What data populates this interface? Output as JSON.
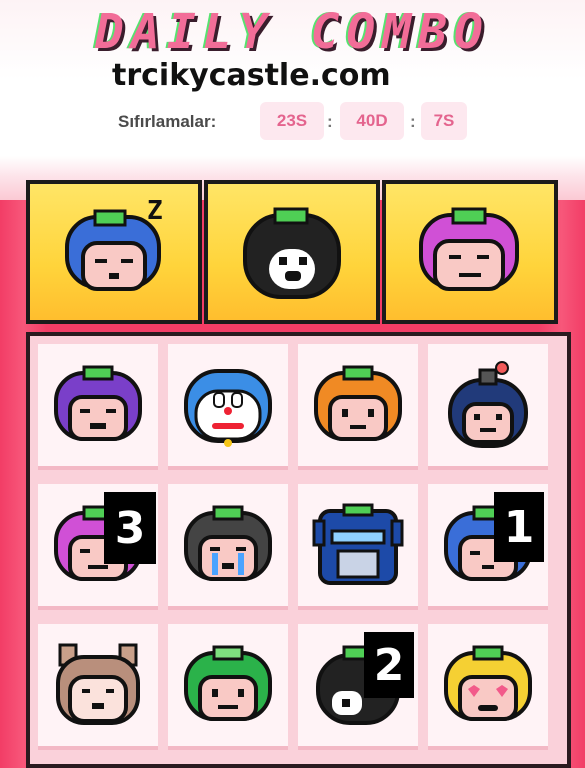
{
  "header": {
    "title": "DAILY COMBO",
    "watermark": "trcikycastle.com"
  },
  "reset": {
    "label": "Sıfırlamalar:",
    "hours": "23S",
    "minutes": "40D",
    "seconds": "7S",
    "separator": ":"
  },
  "combo_slots": [
    {
      "icon": "sleepy-blue-fruit-icon",
      "zz": "Z"
    },
    {
      "icon": "black-white-ghost-fruit-icon"
    },
    {
      "icon": "sad-pink-fruit-icon"
    }
  ],
  "board": {
    "cells": [
      {
        "icon": "angry-purple-fruit-icon",
        "badge": ""
      },
      {
        "icon": "doraemon-icon",
        "badge": ""
      },
      {
        "icon": "orange-fruit-icon",
        "badge": ""
      },
      {
        "icon": "bomb-head-icon",
        "badge": ""
      },
      {
        "icon": "pink-crying-fruit-icon",
        "badge": "3"
      },
      {
        "icon": "grey-crying-fruit-icon",
        "badge": ""
      },
      {
        "icon": "robot-head-icon",
        "badge": ""
      },
      {
        "icon": "blue-fruit-icon",
        "badge": "1"
      },
      {
        "icon": "cat-ears-face-icon",
        "badge": ""
      },
      {
        "icon": "green-smile-fruit-icon",
        "badge": ""
      },
      {
        "icon": "black-ghost-fruit-icon",
        "badge": "2"
      },
      {
        "icon": "heart-eyes-yellow-fruit-icon",
        "badge": ""
      }
    ]
  },
  "colors": {
    "accent": "#f23d66",
    "combo_card": "#ffd43b",
    "time_box_bg": "#fde8ef",
    "time_text": "#e4648e"
  }
}
